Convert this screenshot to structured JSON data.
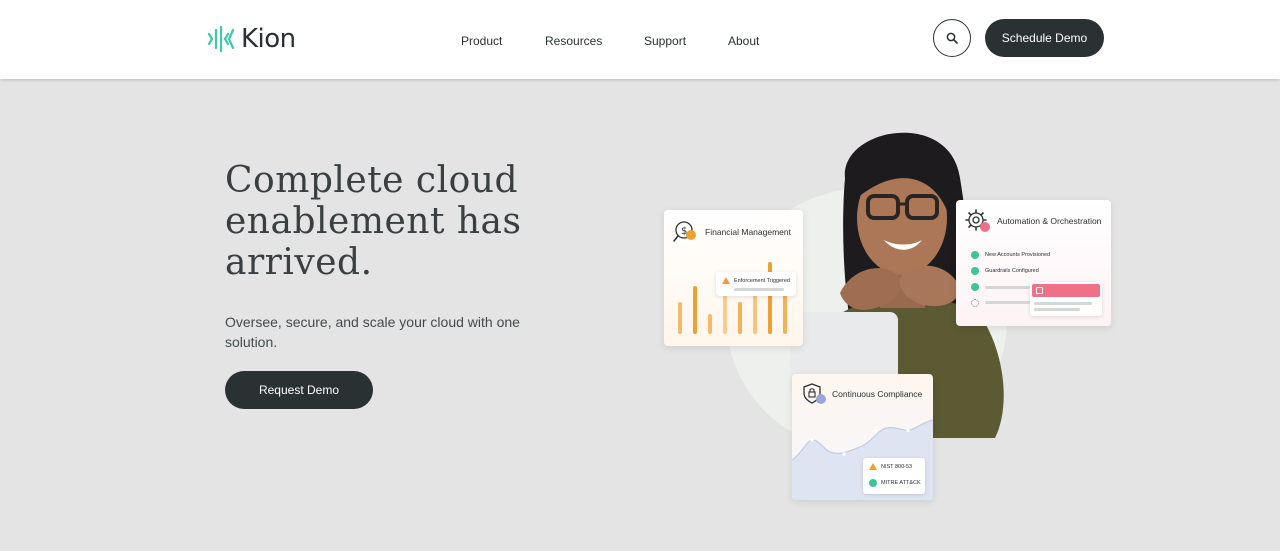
{
  "brand": {
    "name": "Kion",
    "accent": "#3ec9a7"
  },
  "nav": {
    "items": [
      {
        "label": "Product"
      },
      {
        "label": "Resources"
      },
      {
        "label": "Support"
      },
      {
        "label": "About"
      }
    ]
  },
  "header": {
    "search_icon": "search-icon",
    "schedule_demo_label": "Schedule Demo"
  },
  "hero": {
    "title": "Complete cloud enablement has arrived.",
    "subtitle": "Oversee, secure, and scale your cloud with one solution.",
    "cta_label": "Request Demo"
  },
  "cards": {
    "financial": {
      "title": "Financial Management",
      "alert": "Enforcement Triggered",
      "icon": "dollar-search-icon"
    },
    "automation": {
      "title": "Automation & Orchestration",
      "icon": "gear-icon",
      "items": [
        "New Accounts Provisioned",
        "Guardrails Configured"
      ]
    },
    "compliance": {
      "title": "Continuous Compliance",
      "icon": "shield-lock-icon",
      "items": [
        "NIST 800-53",
        "MITRE ATT&CK"
      ]
    }
  },
  "colors": {
    "dark": "#2a3133",
    "background": "#e4e4e4",
    "orange": "#f0a030",
    "pink": "#f07088",
    "green": "#3cc49a"
  }
}
